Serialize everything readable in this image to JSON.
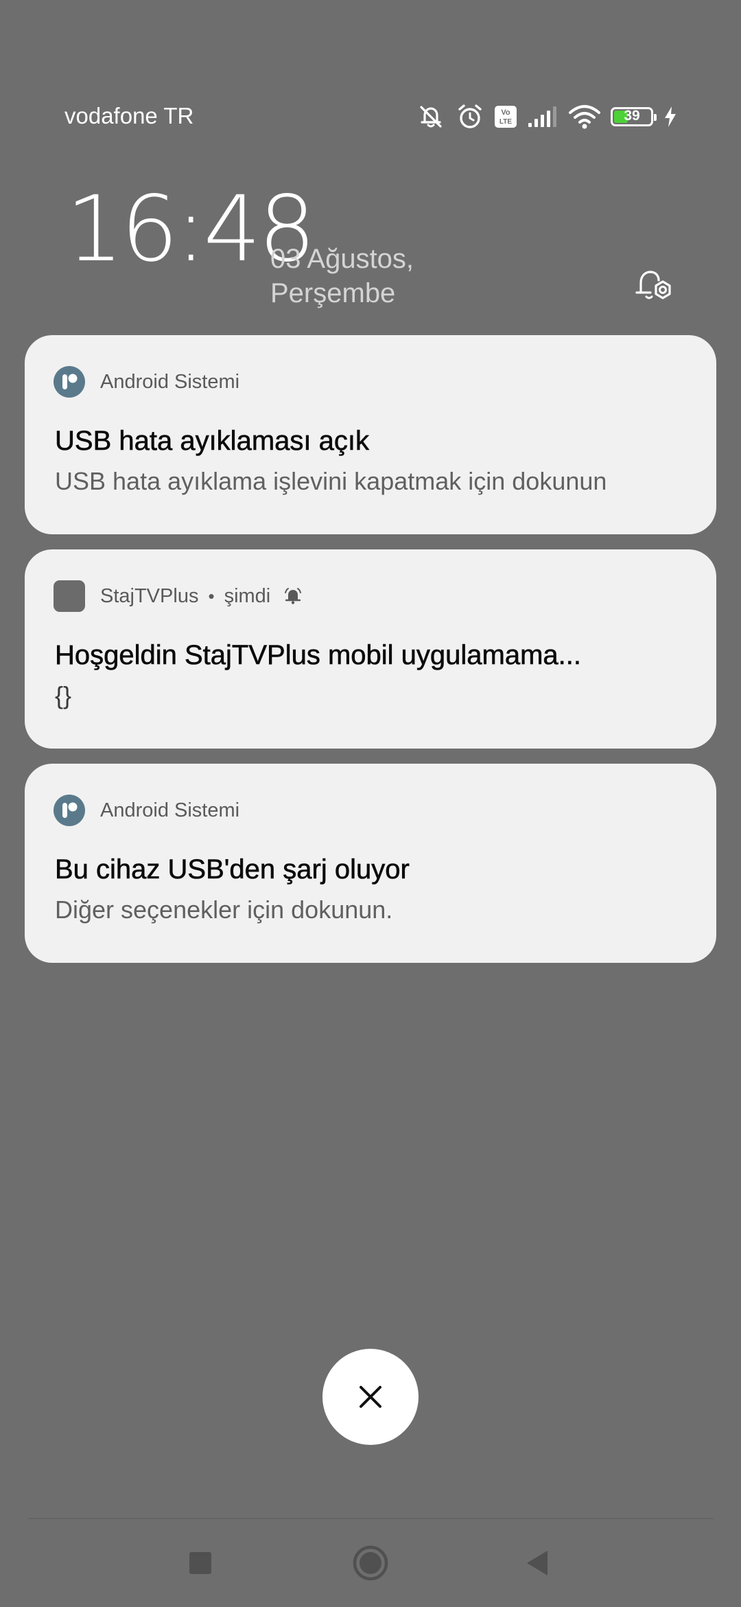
{
  "status_bar": {
    "carrier": "vodafone TR",
    "icons": [
      "bell-muted-icon",
      "alarm-icon",
      "volte-icon",
      "signal-icon",
      "wifi-icon",
      "battery-icon",
      "charging-icon"
    ],
    "volte_text_top": "Vo",
    "volte_text_bottom": "LTE",
    "battery_level": "39",
    "battery_color": "#4cd137"
  },
  "lockscreen": {
    "time": "16:48",
    "date_line1": "03 Ağustos,",
    "date_line2": "Perşembe"
  },
  "notifications": [
    {
      "app": "Android Sistemi",
      "icon": "android-system-icon",
      "title": "USB hata ayıklaması açık",
      "body": "USB hata ayıklama işlevini kapatmak için dokunun"
    },
    {
      "app": "StajTVPlus",
      "separator": "•",
      "time": "şimdi",
      "icon": "app-placeholder-icon",
      "title": "Hoşgeldin StajTVPlus mobil uygulamama...",
      "body": "{}"
    },
    {
      "app": "Android Sistemi",
      "icon": "android-system-icon",
      "title": "Bu cihaz USB'den şarj oluyor",
      "body": "Diğer seçenekler için dokunun."
    }
  ],
  "controls": {
    "dismiss_icon": "close-icon",
    "settings_icon": "notification-settings-icon"
  },
  "nav_bar": {
    "buttons": [
      "recents-icon",
      "home-icon",
      "back-icon"
    ]
  },
  "colors": {
    "background": "#6e6e6e",
    "card": "#f1f1f1",
    "app_icon_accent": "#5a7a8c"
  }
}
